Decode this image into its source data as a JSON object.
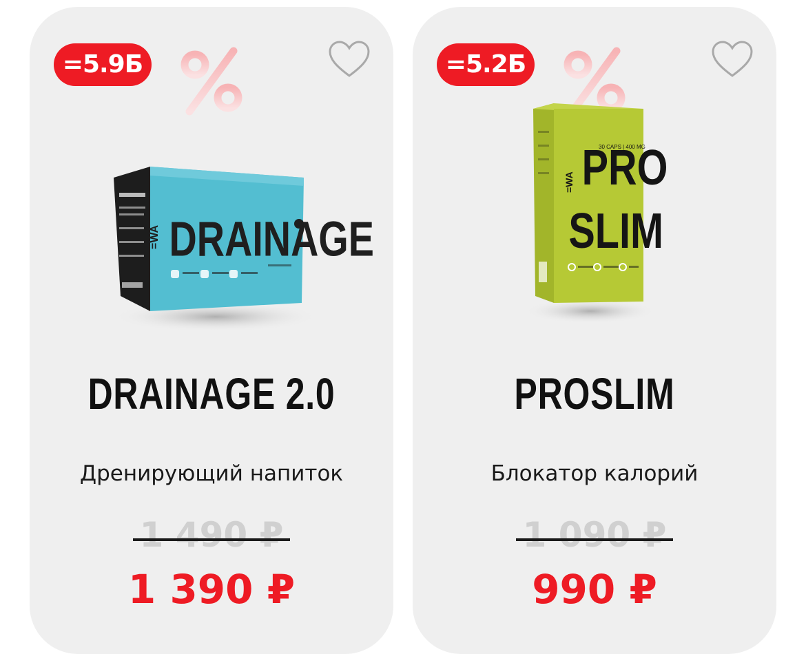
{
  "colors": {
    "accent": "#ee1b24",
    "card_bg": "#efefef",
    "old_price": "#d0d0d0"
  },
  "products": [
    {
      "badge": "=5.9Б",
      "image_icon": "drainage-box-image",
      "box_brand": "DRAINAGE",
      "box_logo": "=WA",
      "title": "DRAINAGE 2.0",
      "subtitle": "Дренирующий напиток",
      "old_price": "1 490 ₽",
      "price": "1 390 ₽"
    },
    {
      "badge": "=5.2Б",
      "image_icon": "proslim-box-image",
      "box_line1": "PRO",
      "box_line2": "SLIM",
      "box_caption": "30 CAPS | 400 MG",
      "box_logo": "=WA",
      "title": "PROSLIM",
      "subtitle": "Блокатор калорий",
      "old_price": "1 090 ₽",
      "price": "990 ₽"
    }
  ]
}
